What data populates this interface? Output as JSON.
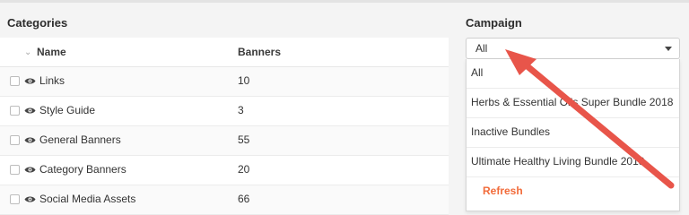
{
  "categories": {
    "title": "Categories",
    "columns": {
      "name": "Name",
      "banners": "Banners"
    },
    "rows": [
      {
        "name": "Links",
        "banners": "10"
      },
      {
        "name": "Style Guide",
        "banners": "3"
      },
      {
        "name": "General Banners",
        "banners": "55"
      },
      {
        "name": "Category Banners",
        "banners": "20"
      },
      {
        "name": "Social Media Assets",
        "banners": "66"
      }
    ]
  },
  "campaign": {
    "title": "Campaign",
    "selected": "All",
    "options": [
      "All",
      "Herbs & Essential Oils Super Bundle 2018",
      "Inactive Bundles",
      "Ultimate Healthy Living Bundle 2018"
    ],
    "refresh_label": "Refresh"
  },
  "colors": {
    "accent": "#f26b3a",
    "arrow": "#e8554a"
  },
  "icons": {
    "sort": "chevron-down-icon",
    "row_icon": "eye-icon",
    "select_caret": "caret-down-icon"
  }
}
